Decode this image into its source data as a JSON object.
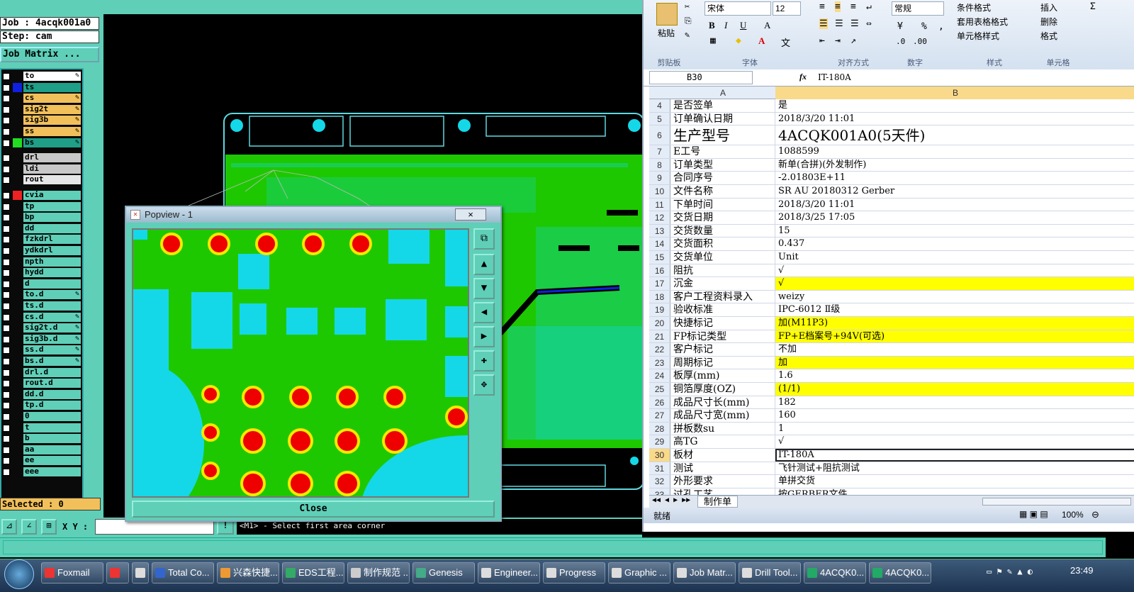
{
  "genesis": {
    "job_label": "Job : 4acqk001a0",
    "step_label": "Step: cam",
    "job_matrix_button": "Job Matrix ...",
    "selected_label": "Selected : 0",
    "xy_label": "X Y :",
    "prompt_message": "<M1> - Select first area corner",
    "layers": [
      {
        "name": "to",
        "bg": "#ffffff",
        "sw": "",
        "edit": true
      },
      {
        "name": "ts",
        "bg": "#1f9f87",
        "sw": "#1020e0",
        "edit": false
      },
      {
        "name": "cs",
        "bg": "#f2c05a",
        "sw": "",
        "edit": true
      },
      {
        "name": "sig2t",
        "bg": "#f2c05a",
        "sw": "",
        "edit": true
      },
      {
        "name": "sig3b",
        "bg": "#f2c05a",
        "sw": "",
        "edit": true
      },
      {
        "name": "ss",
        "bg": "#f2c05a",
        "sw": "",
        "edit": true
      },
      {
        "name": "bs",
        "bg": "#1f9f87",
        "sw": "#22dd22",
        "edit": true
      },
      {
        "name": "drl",
        "bg": "#c8c8c8",
        "sw": "",
        "edit": false
      },
      {
        "name": "ldi",
        "bg": "#c8c8c8",
        "sw": "",
        "edit": false
      },
      {
        "name": "rout",
        "bg": "#e6e6e6",
        "sw": "",
        "edit": false
      },
      {
        "name": "cvia",
        "bg": "#5fcfb8",
        "sw": "#ee2222",
        "edit": false
      },
      {
        "name": "tp",
        "bg": "#5fcfb8",
        "sw": "",
        "edit": false
      },
      {
        "name": "bp",
        "bg": "#5fcfb8",
        "sw": "",
        "edit": false
      },
      {
        "name": "dd",
        "bg": "#5fcfb8",
        "sw": "",
        "edit": false
      },
      {
        "name": "fzkdrl",
        "bg": "#5fcfb8",
        "sw": "",
        "edit": false
      },
      {
        "name": "ydkdrl",
        "bg": "#5fcfb8",
        "sw": "",
        "edit": false
      },
      {
        "name": "npth",
        "bg": "#5fcfb8",
        "sw": "",
        "edit": false
      },
      {
        "name": "hydd",
        "bg": "#5fcfb8",
        "sw": "",
        "edit": false
      },
      {
        "name": "d",
        "bg": "#5fcfb8",
        "sw": "",
        "edit": false
      },
      {
        "name": "to.d",
        "bg": "#5fcfb8",
        "sw": "",
        "edit": true
      },
      {
        "name": "ts.d",
        "bg": "#5fcfb8",
        "sw": "",
        "edit": false
      },
      {
        "name": "cs.d",
        "bg": "#5fcfb8",
        "sw": "",
        "edit": true
      },
      {
        "name": "sig2t.d",
        "bg": "#5fcfb8",
        "sw": "",
        "edit": true
      },
      {
        "name": "sig3b.d",
        "bg": "#5fcfb8",
        "sw": "",
        "edit": true
      },
      {
        "name": "ss.d",
        "bg": "#5fcfb8",
        "sw": "",
        "edit": true
      },
      {
        "name": "bs.d",
        "bg": "#5fcfb8",
        "sw": "",
        "edit": true
      },
      {
        "name": "drl.d",
        "bg": "#5fcfb8",
        "sw": "",
        "edit": false
      },
      {
        "name": "rout.d",
        "bg": "#5fcfb8",
        "sw": "",
        "edit": false
      },
      {
        "name": "dd.d",
        "bg": "#5fcfb8",
        "sw": "",
        "edit": false
      },
      {
        "name": "tp.d",
        "bg": "#5fcfb8",
        "sw": "",
        "edit": false
      },
      {
        "name": "0",
        "bg": "#5fcfb8",
        "sw": "",
        "edit": false
      },
      {
        "name": "t",
        "bg": "#5fcfb8",
        "sw": "",
        "edit": false
      },
      {
        "name": "b",
        "bg": "#5fcfb8",
        "sw": "",
        "edit": false
      },
      {
        "name": "aa",
        "bg": "#5fcfb8",
        "sw": "",
        "edit": false
      },
      {
        "name": "ee",
        "bg": "#5fcfb8",
        "sw": "",
        "edit": false
      },
      {
        "name": "eee",
        "bg": "#5fcfb8",
        "sw": "",
        "edit": false
      }
    ]
  },
  "popview": {
    "title": "Popview - 1",
    "close_button": "Close",
    "close_icon": "×"
  },
  "excel": {
    "ribbon": {
      "paste": "粘贴",
      "font_name": "宋体",
      "font_size": "12",
      "number_format": "常规",
      "cond_format": "条件格式",
      "table_format": "套用表格格式",
      "cell_style": "单元格样式",
      "insert": "插入",
      "delete": "删除",
      "format": "格式",
      "groups": [
        "剪贴板",
        "字体",
        "对齐方式",
        "数字",
        "样式",
        "单元格"
      ]
    },
    "name_box": "B30",
    "fx": "fx",
    "formula_value": "IT-180A",
    "col_a": "A",
    "col_b": "B",
    "rows": [
      {
        "n": "4",
        "a": "是否签单",
        "b": "是",
        "y": false
      },
      {
        "n": "5",
        "a": "订单确认日期",
        "b": "2018/3/20 11:01",
        "y": false
      },
      {
        "n": "6",
        "a": "生产型号",
        "b": "4ACQK001A0(5天件)",
        "y": false,
        "big": true
      },
      {
        "n": "7",
        "a": "E工号",
        "b": "1088599",
        "y": false
      },
      {
        "n": "8",
        "a": "订单类型",
        "b": "新单(合拼)(外发制作)",
        "y": false
      },
      {
        "n": "9",
        "a": "合同序号",
        "b": "-2.01803E+11",
        "y": false
      },
      {
        "n": "10",
        "a": "文件名称",
        "b": "SR AU 20180312 Gerber",
        "y": false
      },
      {
        "n": "11",
        "a": "下单时间",
        "b": "2018/3/20 11:01",
        "y": false
      },
      {
        "n": "12",
        "a": "交货日期",
        "b": "2018/3/25 17:05",
        "y": false
      },
      {
        "n": "13",
        "a": "交货数量",
        "b": "15",
        "y": false
      },
      {
        "n": "14",
        "a": "交货面积",
        "b": "0.437",
        "y": false
      },
      {
        "n": "15",
        "a": "交货单位",
        "b": "Unit",
        "y": false
      },
      {
        "n": "16",
        "a": "阻抗",
        "b": "√",
        "y": false
      },
      {
        "n": "17",
        "a": "沉金",
        "b": "√",
        "y": true
      },
      {
        "n": "18",
        "a": "客户工程资料录入",
        "b": "weizy",
        "y": false
      },
      {
        "n": "19",
        "a": "验收标准",
        "b": "IPC-6012 Ⅱ级",
        "y": false
      },
      {
        "n": "20",
        "a": "快捷标记",
        "b": "加(M11P3)",
        "y": true
      },
      {
        "n": "21",
        "a": "FP标记类型",
        "b": "FP+E档案号+94V(可选)",
        "y": true
      },
      {
        "n": "22",
        "a": "客户标记",
        "b": "不加",
        "y": false
      },
      {
        "n": "23",
        "a": "周期标记",
        "b": "加",
        "y": true
      },
      {
        "n": "24",
        "a": "板厚(mm)",
        "b": "1.6",
        "y": false
      },
      {
        "n": "25",
        "a": "铜箔厚度(OZ)",
        "b": " (1/1)",
        "y": true
      },
      {
        "n": "26",
        "a": "成品尺寸长(mm)",
        "b": "182",
        "y": false
      },
      {
        "n": "27",
        "a": "成品尺寸宽(mm)",
        "b": "160",
        "y": false
      },
      {
        "n": "28",
        "a": "拼板数su",
        "b": "1",
        "y": false
      },
      {
        "n": "29",
        "a": "高TG",
        "b": "√",
        "y": false
      },
      {
        "n": "30",
        "a": "板材",
        "b": "IT-180A",
        "y": false,
        "sel": true
      },
      {
        "n": "31",
        "a": "测试",
        "b": "飞针测试+阻抗测试",
        "y": false
      },
      {
        "n": "32",
        "a": "外形要求",
        "b": "单拼交货",
        "y": false
      },
      {
        "n": "33",
        "a": "过孔工艺",
        "b": "按GERBER文件",
        "y": false
      }
    ],
    "sheet_tab": "制作单",
    "status_ready": "就绪",
    "zoom": "100%"
  },
  "taskbar": {
    "items": [
      {
        "label": "Foxmail",
        "color": "#e33"
      },
      {
        "label": "",
        "color": "#e33"
      },
      {
        "label": "",
        "color": "#ddd"
      },
      {
        "label": "Total Co...",
        "color": "#36c"
      },
      {
        "label": "兴森快捷...",
        "color": "#e93"
      },
      {
        "label": "EDS工程...",
        "color": "#3a6"
      },
      {
        "label": "制作规范 ...",
        "color": "#ccc"
      },
      {
        "label": "Genesis",
        "color": "#4a8"
      },
      {
        "label": "Engineer...",
        "color": "#ddd"
      },
      {
        "label": "Progress",
        "color": "#ddd"
      },
      {
        "label": "Graphic ...",
        "color": "#ddd"
      },
      {
        "label": "Job Matr...",
        "color": "#ddd"
      },
      {
        "label": "Drill Tool...",
        "color": "#ddd"
      },
      {
        "label": "4ACQK0...",
        "color": "#2a6"
      },
      {
        "label": "4ACQK0...",
        "color": "#2a6"
      }
    ],
    "clock": "23:49"
  }
}
